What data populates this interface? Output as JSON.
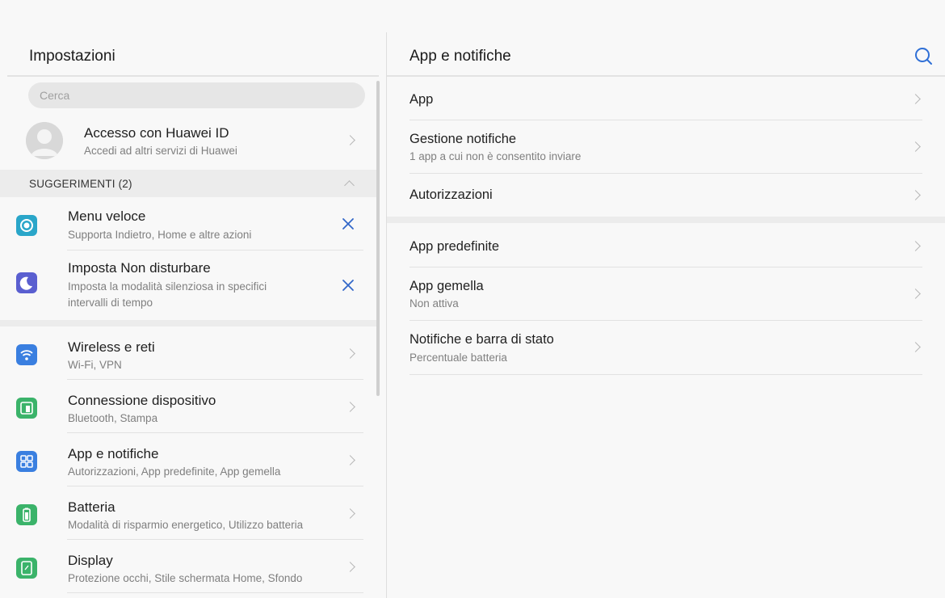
{
  "left": {
    "title": "Impostazioni",
    "search_placeholder": "Cerca",
    "account": {
      "title": "Accesso con Huawei ID",
      "subtitle": "Accedi ad altri servizi di Huawei"
    },
    "suggestions_label": "SUGGERIMENTI (2)",
    "suggestions": [
      {
        "title": "Menu veloce",
        "subtitle": "Supporta Indietro, Home e altre azioni",
        "icon": "quick-menu-icon",
        "color": "#2aa6c9"
      },
      {
        "title": "Imposta Non disturbare",
        "subtitle_line1": "Imposta la modalità silenziosa in specifici",
        "subtitle_line2": "intervalli di tempo",
        "icon": "moon-icon",
        "color": "#5a5fd0"
      }
    ],
    "items": [
      {
        "title": "Wireless e reti",
        "subtitle": "Wi-Fi, VPN",
        "icon": "wifi-icon",
        "color": "#3a7fe0"
      },
      {
        "title": "Connessione dispositivo",
        "subtitle": "Bluetooth, Stampa",
        "icon": "device-connection-icon",
        "color": "#3bb36a"
      },
      {
        "title": "App e notifiche",
        "subtitle": "Autorizzazioni, App predefinite, App gemella",
        "icon": "apps-grid-icon",
        "color": "#3a7fe0"
      },
      {
        "title": "Batteria",
        "subtitle": "Modalità di risparmio energetico, Utilizzo batteria",
        "icon": "battery-icon",
        "color": "#3bb36a"
      },
      {
        "title": "Display",
        "subtitle": "Protezione occhi, Stile schermata Home, Sfondo",
        "icon": "display-icon",
        "color": "#3bb36a"
      }
    ]
  },
  "right": {
    "title": "App e notifiche",
    "items": [
      {
        "title": "App"
      },
      {
        "title": "Gestione notifiche",
        "subtitle": "1 app a cui non è consentito inviare"
      },
      {
        "title": "Autorizzazioni"
      },
      {
        "title": "App predefinite"
      },
      {
        "title": "App gemella",
        "subtitle": "Non attiva"
      },
      {
        "title": "Notifiche e barra di stato",
        "subtitle": "Percentuale batteria"
      }
    ]
  },
  "colors": {
    "accent": "#2f6fd6",
    "close": "#3267c8"
  }
}
